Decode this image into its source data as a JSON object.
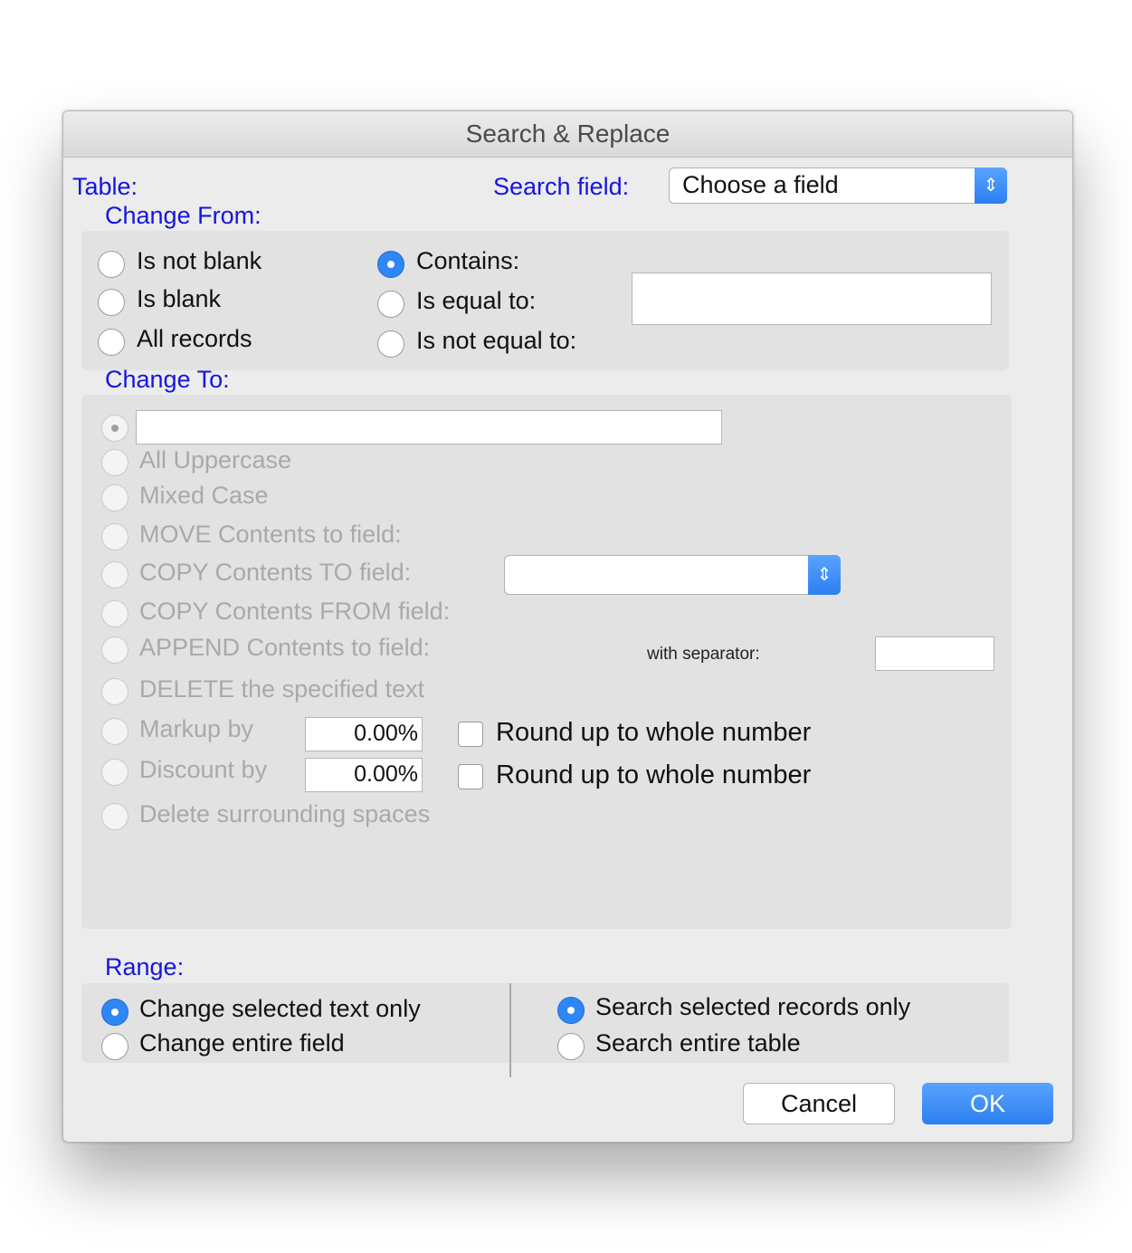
{
  "window": {
    "title": "Search & Replace"
  },
  "header": {
    "table_label": "Table:",
    "search_field_label": "Search field:",
    "search_field_value": "Choose a field"
  },
  "change_from": {
    "heading": "Change From:",
    "options": [
      "Is not blank",
      "Is blank",
      "All records",
      "Contains:",
      "Is equal to:",
      "Is not equal to:"
    ],
    "selected": "Contains:",
    "value_input": ""
  },
  "change_to": {
    "heading": "Change To:",
    "text_value": "",
    "options": [
      "All Uppercase",
      "Mixed Case",
      "MOVE Contents to field:",
      "COPY Contents TO field:",
      "COPY Contents FROM field:",
      "APPEND Contents to field:",
      "DELETE the specified text",
      "Markup by",
      "Discount by",
      "Delete surrounding spaces"
    ],
    "target_field_value": "",
    "separator_label": "with separator:",
    "separator_value": "",
    "markup_value": "0.00%",
    "discount_value": "0.00%",
    "round_markup_label": "Round up to whole number",
    "round_discount_label": "Round up to whole number"
  },
  "range": {
    "heading": "Range:",
    "text_options": [
      "Change selected text only",
      "Change entire field"
    ],
    "text_selected": "Change selected text only",
    "record_options": [
      "Search selected records only",
      "Search entire table"
    ],
    "record_selected": "Search selected records only"
  },
  "buttons": {
    "cancel": "Cancel",
    "ok": "OK"
  },
  "colors": {
    "accent": "#2f86f5",
    "label_blue": "#1515e0",
    "disabled_text": "#a9a9a9"
  }
}
